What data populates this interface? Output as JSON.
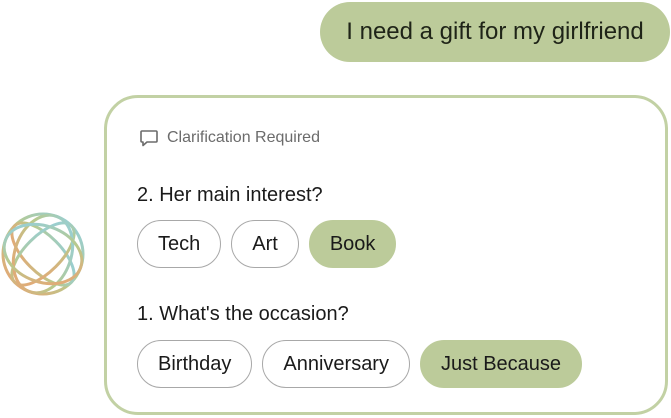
{
  "user_message": "I need a gift for my girlfriend",
  "card": {
    "header": "Clarification Required",
    "header_icon": "speech-bubble-icon",
    "questions": [
      {
        "label": "2. Her main interest?",
        "options": [
          "Tech",
          "Art",
          "Book"
        ],
        "selected": "Book"
      },
      {
        "label": "1. What's the occasion?",
        "options": [
          "Birthday",
          "Anniversary",
          "Just Because"
        ],
        "selected": "Just Because"
      }
    ]
  },
  "colors": {
    "accent": "#bccb9a",
    "card_border": "#c2d1a4",
    "chip_border": "#a8a8a8",
    "header_text": "#6b6b6b"
  },
  "avatar_icon": "ai-globe-logo-icon"
}
